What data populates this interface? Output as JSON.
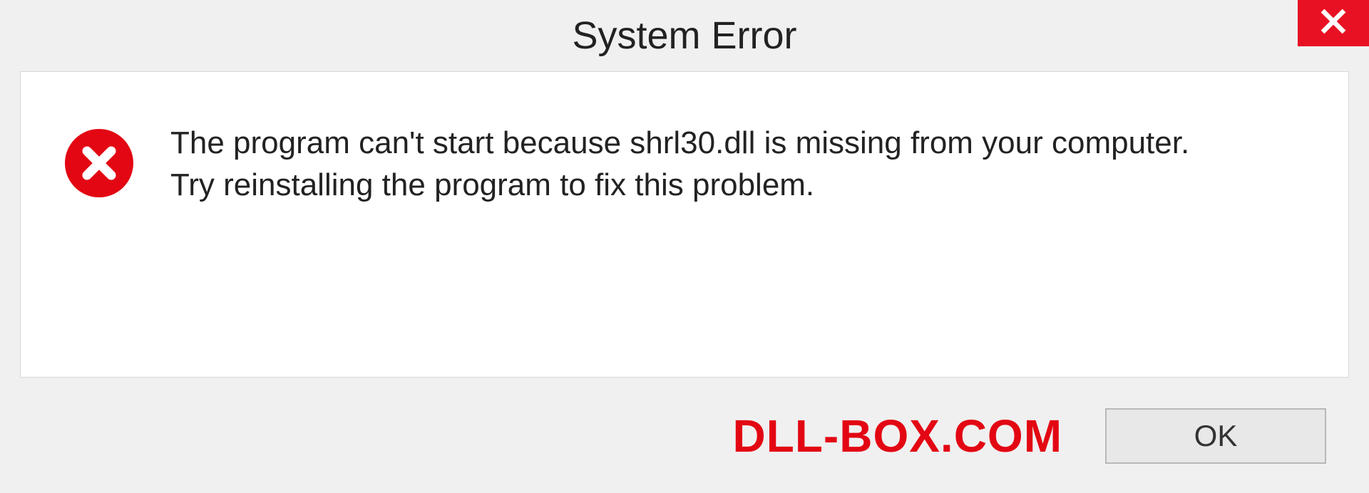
{
  "titlebar": {
    "title": "System Error"
  },
  "message": {
    "line1": "The program can't start because shrl30.dll is missing from your computer.",
    "line2": "Try reinstalling the program to fix this problem."
  },
  "footer": {
    "watermark": "DLL-BOX.COM",
    "ok_label": "OK"
  },
  "icons": {
    "close": "close-icon",
    "error": "error-circle-x-icon"
  },
  "colors": {
    "close_bg": "#e81123",
    "error_red": "#e30613",
    "panel_bg": "#ffffff",
    "page_bg": "#f0f0f0"
  }
}
